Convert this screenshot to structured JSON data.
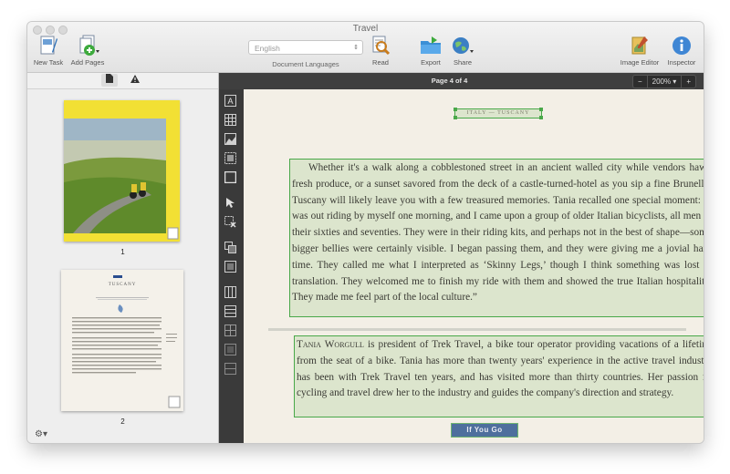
{
  "window": {
    "title": "Travel"
  },
  "toolbar": {
    "new_task": "New Task",
    "add_pages": "Add Pages",
    "document_languages": "Document Languages",
    "language_value": "English",
    "read": "Read",
    "export": "Export",
    "share": "Share",
    "image_editor": "Image Editor",
    "inspector": "Inspector"
  },
  "sidebar": {
    "pages": [
      {
        "label": "1"
      },
      {
        "label": "2"
      }
    ],
    "page2_heading": "TUSCANY"
  },
  "viewer": {
    "page_indicator": "Page 4 of 4",
    "zoom_minus": "−",
    "zoom_level": "200% ▾",
    "zoom_plus": "+"
  },
  "document": {
    "header": "ITALY — TUSCANY",
    "paragraph1": "Whether it's a walk along a cobblestoned street in an ancient walled city while vendors hawk fresh produce, or a sunset savored from the deck of a castle-turned-hotel as you sip a fine Brunello, Tuscany will likely leave you with a few treasured memories. Tania recalled one special moment: “I was out riding by myself one morning, and I came upon a group of older Italian bicyclists, all men in their sixties and seventies. They were in their riding kits, and perhaps not in the best of shape—some bigger bellies were certainly visible. I began passing them, and they were giving me a jovial hard time. They called me what I interpreted as ‘Skinny Legs,’ though I think something was lost in translation. They welcomed me to finish my ride with them and showed the true Italian hospitality. They made me feel part of the local culture.”",
    "name": "Tania Worgull",
    "paragraph2": " is president of Trek Travel, a bike tour operator providing vacations of a lifetime from the seat of a bike. Tania has more than twenty years' experience in the active travel industry, has been with Trek Travel ten years, and has visited more than thirty countries. Her passion for cycling and travel drew her to the industry and guides the company's direction and strategy.",
    "banner": "If You Go"
  },
  "colors": {
    "zone_border": "#49a849",
    "banner_bg": "#4e6f9d",
    "toolbar_dark": "#3f3f3f"
  }
}
